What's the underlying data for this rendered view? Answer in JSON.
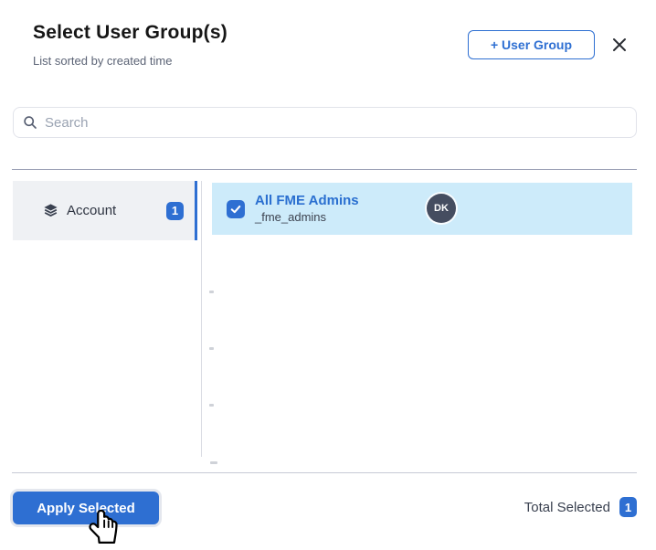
{
  "header": {
    "title": "Select User Group(s)",
    "subtitle": "List sorted by created time",
    "add_button_label": "+ User Group",
    "close_icon": "x-mark"
  },
  "search": {
    "placeholder": "Search",
    "icon": "magnifier"
  },
  "sidebar": {
    "items": [
      {
        "label": "Account",
        "count": "1",
        "icon": "layers-icon",
        "active": true
      }
    ]
  },
  "list": {
    "items": [
      {
        "name": "All FME Admins",
        "id": "_fme_admins",
        "avatar_initials": "DK",
        "selected": true
      }
    ]
  },
  "footer": {
    "apply_button_label": "Apply Selected",
    "total_selected_label": "Total Selected",
    "total_selected_count": "1"
  },
  "cursor": {
    "icon": "hand-pointer-icon"
  },
  "colors": {
    "accent": "#2e6fd2",
    "selected_row_bg": "#cdebfa",
    "sidebar_item_bg": "#eff1f4",
    "avatar_bg": "#454d60",
    "link_text": "#2a6fd0"
  }
}
